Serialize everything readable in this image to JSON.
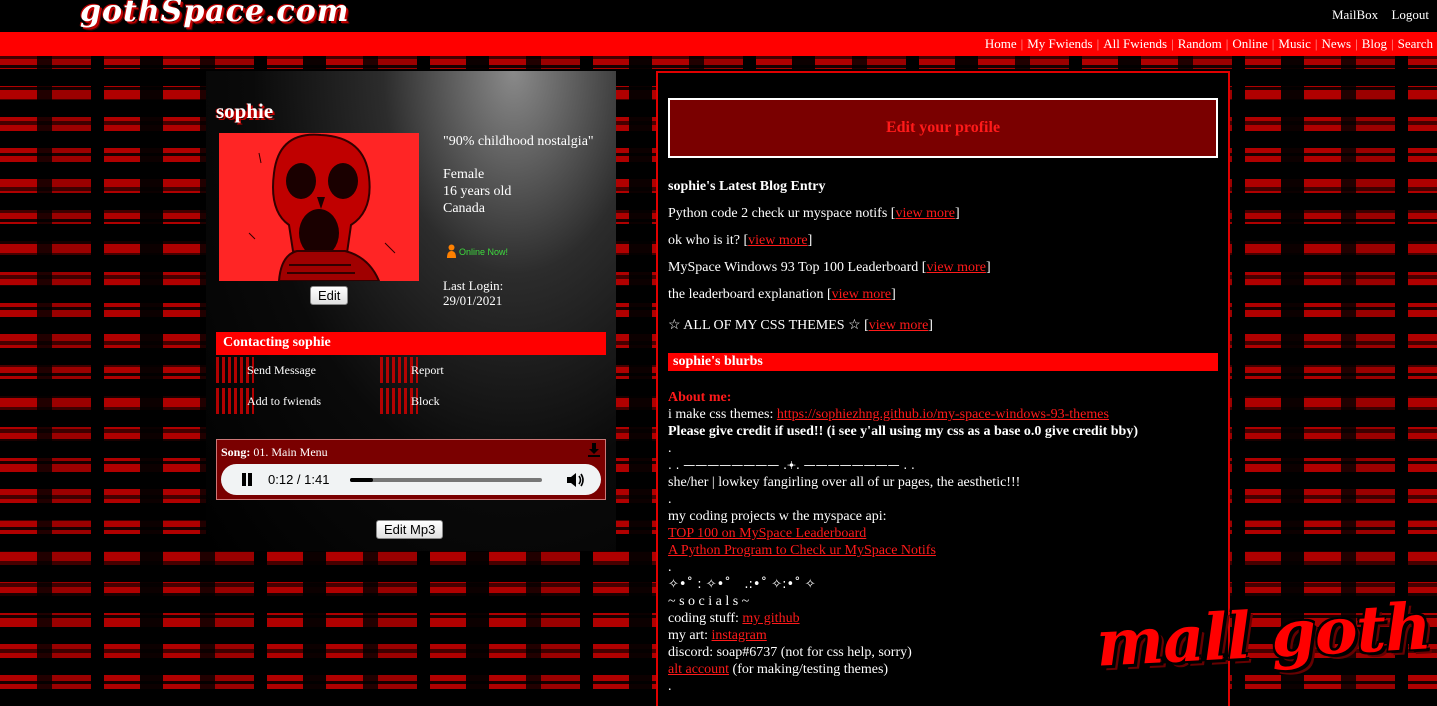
{
  "site": {
    "logo": "gothSpace.com",
    "top_links": [
      "MailBox",
      "Logout"
    ],
    "nav": [
      "Home",
      "My Fwiends",
      "All Fwiends",
      "Random",
      "Online",
      "Music",
      "News",
      "Blog",
      "Search"
    ],
    "sticker": "mall goth",
    "colors": {
      "accent": "#ff0000",
      "dark_red": "#7a0000",
      "background": "#000000"
    }
  },
  "profile": {
    "name": "sophie",
    "quote": "\"90% childhood nostalgia\"",
    "gender": "Female",
    "age": "16 years old",
    "country": "Canada",
    "online": "Online Now!",
    "last_login_label": "Last Login:",
    "last_login": "29/01/2021",
    "edit_label": "Edit"
  },
  "contact": {
    "title": "Contacting sophie",
    "items": [
      "Send Message",
      "Report",
      "Add to fwiends",
      "Block"
    ]
  },
  "song": {
    "label": "Song:",
    "title": "01. Main Menu",
    "time": "0:12 / 1:41",
    "progress": 0.12,
    "edit_label": "Edit Mp3"
  },
  "main": {
    "edit_profile": "Edit your profile",
    "blog_title": "sophie's Latest Blog Entry",
    "view_more": "view more",
    "blog_entries": [
      "Python code 2 check ur myspace notifs",
      "ok who is it?",
      "MySpace Windows 93 Top 100 Leaderboard",
      "the leaderboard explanation",
      "☆ ALL OF MY CSS THEMES ☆"
    ],
    "blurbs_title": "sophie's blurbs",
    "about_label": "About me:",
    "css_themes_text": "i make css themes: ",
    "css_themes_link": "https://sophiezhng.github.io/my-space-windows-93-themes",
    "credit": "Please give credit if used!! (i see y'all using my css as a base o.0 give credit bby)",
    "dot": ".",
    "divider": ". . ———————— .𖥔. ———————— . .",
    "pronouns": "she/her | lowkey fangirling over all of ur pages, the aesthetic!!!",
    "projects_label": "my coding projects w the myspace api:",
    "project_links": [
      "TOP 100 on MySpace Leaderboard",
      "A Python Program to Check ur MySpace Notifs"
    ],
    "sparkles": "✧•˚ : ✧•˚ ⠀.:•˚ ✧:•˚ ✧",
    "socials": "~ s o c i a l s ~",
    "coding_label": "coding stuff: ",
    "coding_link": "my github",
    "art_label": "my art: ",
    "art_link": "instagram",
    "discord": "discord: soap#6737 (not for css help, sorry)",
    "alt_link": "alt account",
    "alt_text": " (for making/testing themes)"
  }
}
